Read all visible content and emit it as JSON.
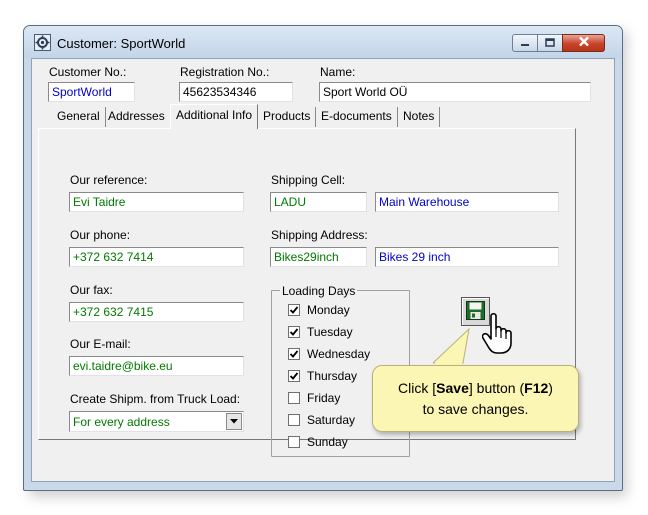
{
  "window": {
    "title": "Customer: SportWorld"
  },
  "header": {
    "customer_no_label": "Customer No.:",
    "customer_no": "SportWorld",
    "registration_no_label": "Registration No.:",
    "registration_no": "45623534346",
    "name_label": "Name:",
    "name": "Sport World OÜ"
  },
  "tabs": [
    {
      "label": "General"
    },
    {
      "label": "Addresses"
    },
    {
      "label": "Additional Info"
    },
    {
      "label": "Products"
    },
    {
      "label": "E-documents"
    },
    {
      "label": "Notes"
    }
  ],
  "active_tab": "Additional Info",
  "additional_info": {
    "our_reference_label": "Our reference:",
    "our_reference": "Evi Taidre",
    "our_phone_label": "Our phone:",
    "our_phone": "+372 632 7414",
    "our_fax_label": "Our fax:",
    "our_fax": "+372 632 7415",
    "our_email_label": "Our E-mail:",
    "our_email": "evi.taidre@bike.eu",
    "create_shipm_label": "Create Shipm. from Truck Load:",
    "create_shipm_value": "For every address",
    "shipping_cell_label": "Shipping Cell:",
    "shipping_cell_code": "LADU",
    "shipping_cell_name": "Main Warehouse",
    "shipping_address_label": "Shipping Address:",
    "shipping_address_code": "Bikes29inch",
    "shipping_address_name": "Bikes 29 inch",
    "loading_days_label": "Loading Days",
    "loading_days": [
      {
        "day": "Monday",
        "checked": true
      },
      {
        "day": "Tuesday",
        "checked": true
      },
      {
        "day": "Wednesday",
        "checked": true
      },
      {
        "day": "Thursday",
        "checked": true
      },
      {
        "day": "Friday",
        "checked": false
      },
      {
        "day": "Saturday",
        "checked": false
      },
      {
        "day": "Sunday",
        "checked": false
      }
    ]
  },
  "callout": {
    "text_before": "Click [",
    "save_word": "Save",
    "text_middle": "] button (",
    "key": "F12",
    "text_after": ")",
    "line2": "to save changes."
  },
  "icons": [
    "app-icon",
    "minimize-icon",
    "maximize-icon",
    "close-icon",
    "floppy-disk-icon",
    "hand-cursor-icon",
    "checkmark-icon",
    "dropdown-arrow-icon"
  ],
  "colors": {
    "link_blue": "#0000cc",
    "value_green": "#007a00",
    "callout_bg": "#fbf6b3",
    "close_red": "#c7432b"
  }
}
